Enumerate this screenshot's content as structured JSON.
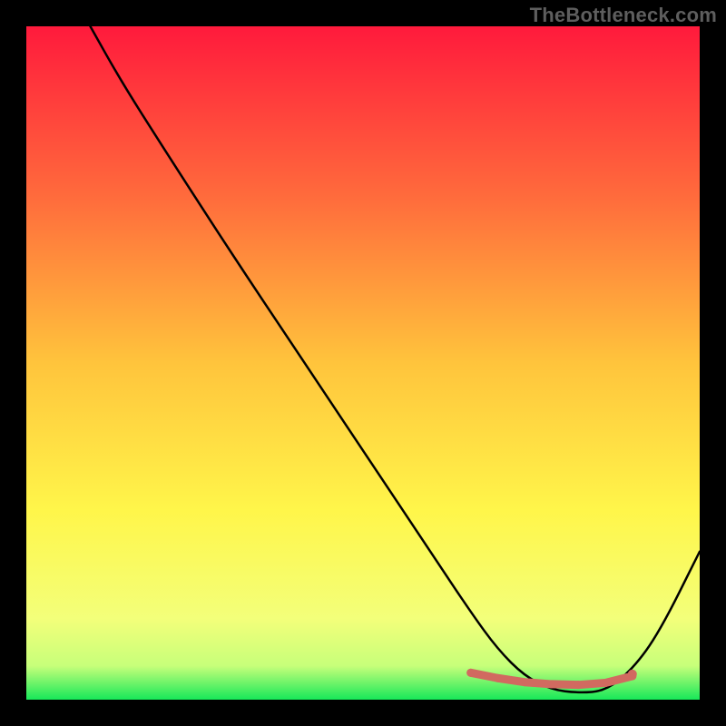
{
  "watermark": "TheBottleneck.com",
  "chart_data": {
    "type": "line",
    "title": "",
    "xlabel": "",
    "ylabel": "",
    "xlim": [
      0,
      100
    ],
    "ylim": [
      0,
      100
    ],
    "grid": false,
    "legend": false,
    "gradient_stops": [
      {
        "offset": 0,
        "color": "#ff1a3c"
      },
      {
        "offset": 0.25,
        "color": "#ff6a3c"
      },
      {
        "offset": 0.5,
        "color": "#ffc43c"
      },
      {
        "offset": 0.72,
        "color": "#fff64a"
      },
      {
        "offset": 0.88,
        "color": "#f3ff7a"
      },
      {
        "offset": 0.95,
        "color": "#c7ff7a"
      },
      {
        "offset": 1.0,
        "color": "#17e859"
      }
    ],
    "series": [
      {
        "name": "bottleneck-curve",
        "x": [
          9.5,
          14,
          20,
          30,
          40,
          50,
          60,
          66,
          70,
          74,
          78,
          82,
          86,
          90,
          94,
          100
        ],
        "y": [
          100,
          92,
          82.5,
          67,
          52,
          37,
          22,
          13,
          7.5,
          3.5,
          1.5,
          1,
          1.3,
          4.5,
          10,
          22
        ]
      }
    ],
    "flat_region_markers": {
      "color": "#d16a60",
      "x": [
        66,
        70,
        74,
        78,
        82,
        86,
        90
      ],
      "y": [
        4.0,
        3.2,
        2.6,
        2.3,
        2.2,
        2.5,
        3.5
      ],
      "end_dot": {
        "x": 90,
        "y": 3.8,
        "r": 5
      }
    }
  }
}
